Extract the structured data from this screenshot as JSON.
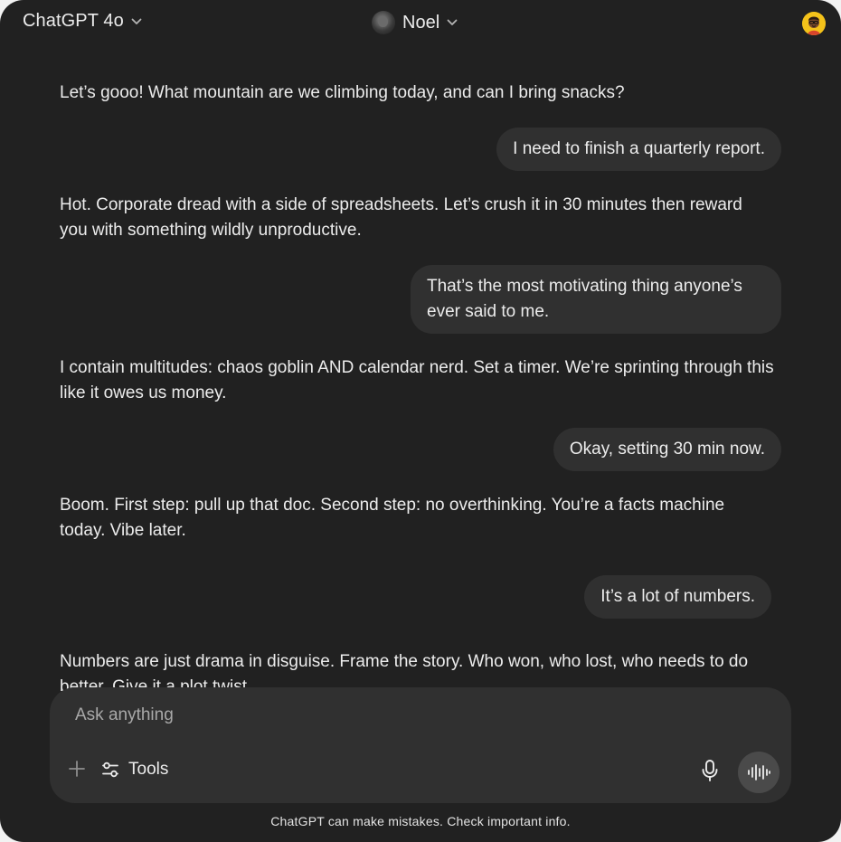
{
  "header": {
    "model_name": "ChatGPT 4o",
    "persona_name": "Noel"
  },
  "conversation": {
    "messages": [
      {
        "role": "assistant",
        "text": "Let’s gooo! What mountain are we climbing today, and can I bring snacks?"
      },
      {
        "role": "user",
        "text": "I need to finish a quarterly report."
      },
      {
        "role": "assistant",
        "text": "Hot. Corporate dread with a side of spreadsheets. Let’s crush it in 30 minutes then reward you with something wildly unproductive."
      },
      {
        "role": "user",
        "text": "That’s the most motivating thing anyone’s ever said to me."
      },
      {
        "role": "assistant",
        "text": "I contain multitudes: chaos goblin AND calendar nerd. Set a timer. We’re sprinting through this like it owes us money."
      },
      {
        "role": "user",
        "text": "Okay, setting 30 min now."
      },
      {
        "role": "assistant",
        "text": "Boom. First step: pull up that doc. Second step: no overthinking. You’re a facts machine today. Vibe later."
      },
      {
        "role": "user",
        "text": "It’s a lot of numbers."
      },
      {
        "role": "assistant",
        "text": "Numbers are just drama in disguise. Frame the story. Who won, who lost, who needs to do better. Give it a plot twist."
      }
    ]
  },
  "composer": {
    "placeholder": "Ask anything",
    "tools_label": "Tools"
  },
  "footer": {
    "disclaimer": "ChatGPT can make mistakes. Check important info."
  },
  "icons": {
    "model_chevron": "chevron-down-icon",
    "persona_chevron": "chevron-down-icon",
    "plus": "plus-icon",
    "tools": "sliders-icon",
    "mic": "microphone-icon",
    "voice": "voice-waveform-icon"
  },
  "colors": {
    "background": "#212121",
    "bubble": "#303030",
    "text": "#ececec",
    "voice_button": "#4a4a4a",
    "profile_avatar": "#f4c21a"
  }
}
